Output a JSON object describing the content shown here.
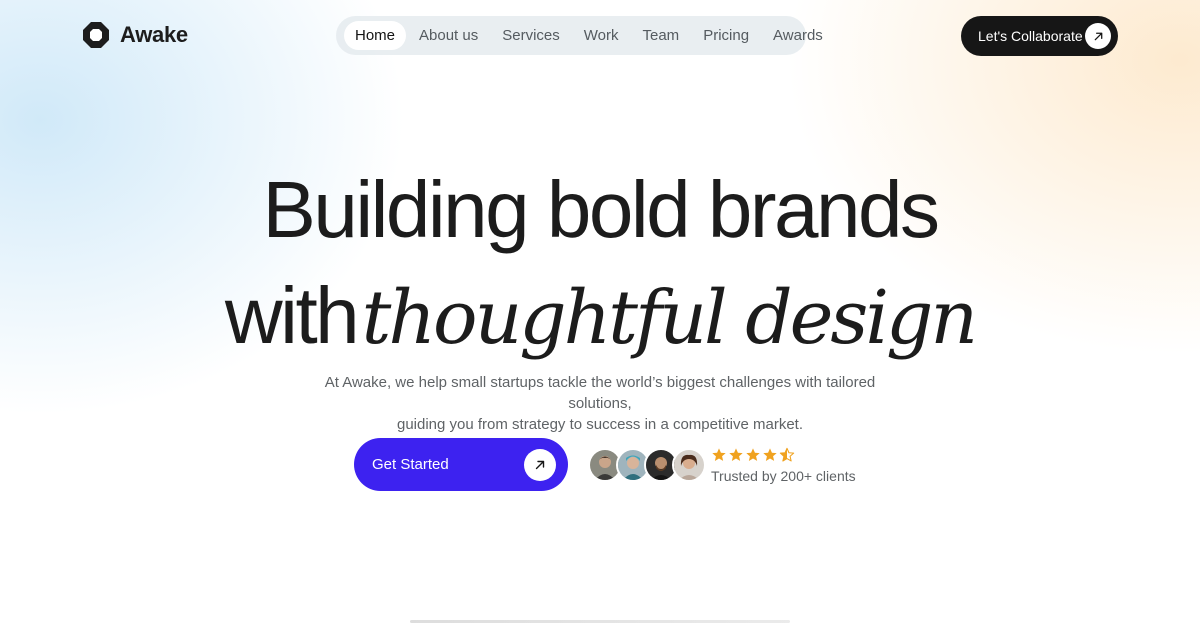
{
  "brand": {
    "name": "Awake",
    "logo_icon": "octagon-ring-icon"
  },
  "nav": {
    "items": [
      {
        "label": "Home",
        "active": true
      },
      {
        "label": "About us",
        "active": false
      },
      {
        "label": "Services",
        "active": false
      },
      {
        "label": "Work",
        "active": false
      },
      {
        "label": "Team",
        "active": false
      },
      {
        "label": "Pricing",
        "active": false
      },
      {
        "label": "Awards",
        "active": false
      }
    ]
  },
  "header": {
    "cta_label": "Let's Collaborate",
    "cta_icon": "arrow-up-right-icon"
  },
  "hero": {
    "title_line1": "Building bold brands",
    "title_line2_plain": "with",
    "title_line2_emphasis": "thoughtful design",
    "subtitle_line1": "At Awake, we help small startups tackle the world’s biggest challenges with tailored solutions,",
    "subtitle_line2": "guiding you from strategy to success in a competitive market.",
    "primary_cta": {
      "label": "Get Started",
      "icon": "arrow-up-right-icon"
    }
  },
  "social_proof": {
    "avatar_count": 4,
    "rating": 4.5,
    "rating_max": 5,
    "trusted_text": "Trusted by 200+ clients"
  },
  "colors": {
    "accent": "#3d22f0",
    "dark": "#161616",
    "star": "#f0a21f"
  }
}
